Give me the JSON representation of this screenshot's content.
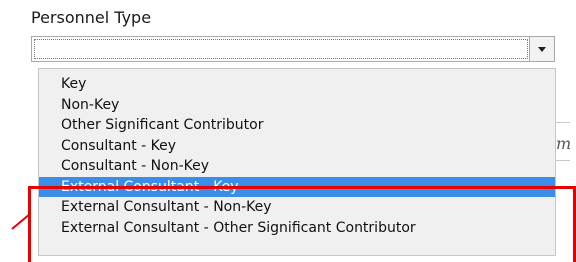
{
  "field": {
    "label": "Personnel Type",
    "selected_value": ""
  },
  "dropdown": {
    "options": [
      "Key",
      "Non-Key",
      "Other Significant Contributor",
      "Consultant - Key",
      "Consultant - Non-Key",
      "External Consultant - Key",
      "External Consultant - Non-Key",
      "External Consultant - Other Significant Contributor"
    ],
    "highlighted_option": "External Consultant - Key"
  },
  "background_fragment": "m",
  "colors": {
    "highlight": "#3b8ee8",
    "annotation": "#e60000",
    "dropdown_bg": "#f0f0f0"
  }
}
